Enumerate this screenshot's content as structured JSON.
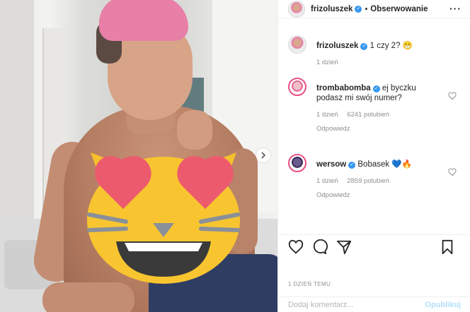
{
  "post": {
    "author": "frizoluszek",
    "follow_label": "Obserwowanie",
    "more_icon": "more-dots-icon",
    "caption": "1 czy 2?",
    "caption_emoji": "😁",
    "caption_age": "1 dzień"
  },
  "comments": [
    {
      "author": "trombabomba",
      "text": "ej byczku podasz mi swój numer?",
      "age": "1 dzień",
      "likes": "6241 polubień",
      "reply_label": "Odpowiedz"
    },
    {
      "author": "wersow",
      "text": "Bobasek 💙🔥",
      "age": "1 dzień",
      "likes": "2859 polubień",
      "reply_label": "Odpowiedz"
    }
  ],
  "timestamp": "1 DZIEŃ TEMU",
  "add_comment": {
    "placeholder": "Dodaj komentarz...",
    "publish_label": "Opublikuj"
  },
  "colors": {
    "verified": "#3897f0",
    "publish": "#b2dffc",
    "muted": "#8e8e8e"
  }
}
